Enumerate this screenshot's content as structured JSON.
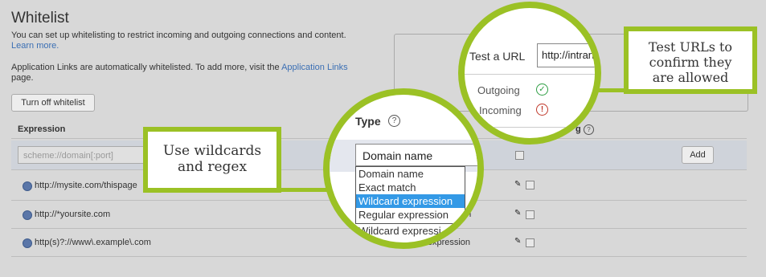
{
  "page": {
    "title": "Whitelist",
    "description_line1": "You can set up whitelisting to restrict incoming and outgoing connections and content.",
    "learn_more": "Learn more.",
    "auto_text": "Application Links are automatically whitelisted. To add more, visit the",
    "app_links_link": "Application Links",
    "auto_text_end": "page.",
    "turn_off_button": "Turn off whitelist"
  },
  "table": {
    "col_expression": "Expression",
    "col_type": "Type",
    "col_incoming_suffix": "g",
    "expression_placeholder": "scheme://domain[:port]",
    "add_button": "Add",
    "rows": [
      {
        "expression": "http://mysite.com/thispage",
        "type": ""
      },
      {
        "expression": "http://*yoursite.com",
        "type": "on"
      },
      {
        "expression": "http(s)?://www\\.example\\.com",
        "type": "ar expression"
      }
    ]
  },
  "type_dropdown": {
    "selected": "Domain name",
    "options": [
      "Domain name",
      "Exact match",
      "Wildcard expression",
      "Regular expression"
    ],
    "highlighted_index": 2,
    "below_option": "Wildcard expressi"
  },
  "test_panel": {
    "label": "Test a URL",
    "input_value": "http://intranet.site.co",
    "outgoing_label": "Outgoing",
    "incoming_label": "Incoming",
    "outgoing_status": "allowed",
    "incoming_status": "blocked",
    "behind_text": "Test a URL",
    "behind_input": "http://intranet.site.co"
  },
  "callouts": {
    "wildcards": "Use wildcards and regex",
    "test_urls": "Test URLs to confirm they are allowed"
  },
  "colors": {
    "accent_green": "#9bc125",
    "link_blue": "#3b6fb4",
    "highlight_blue": "#3399e6",
    "ok_green": "#2e9e44",
    "error_red": "#c0392b"
  }
}
